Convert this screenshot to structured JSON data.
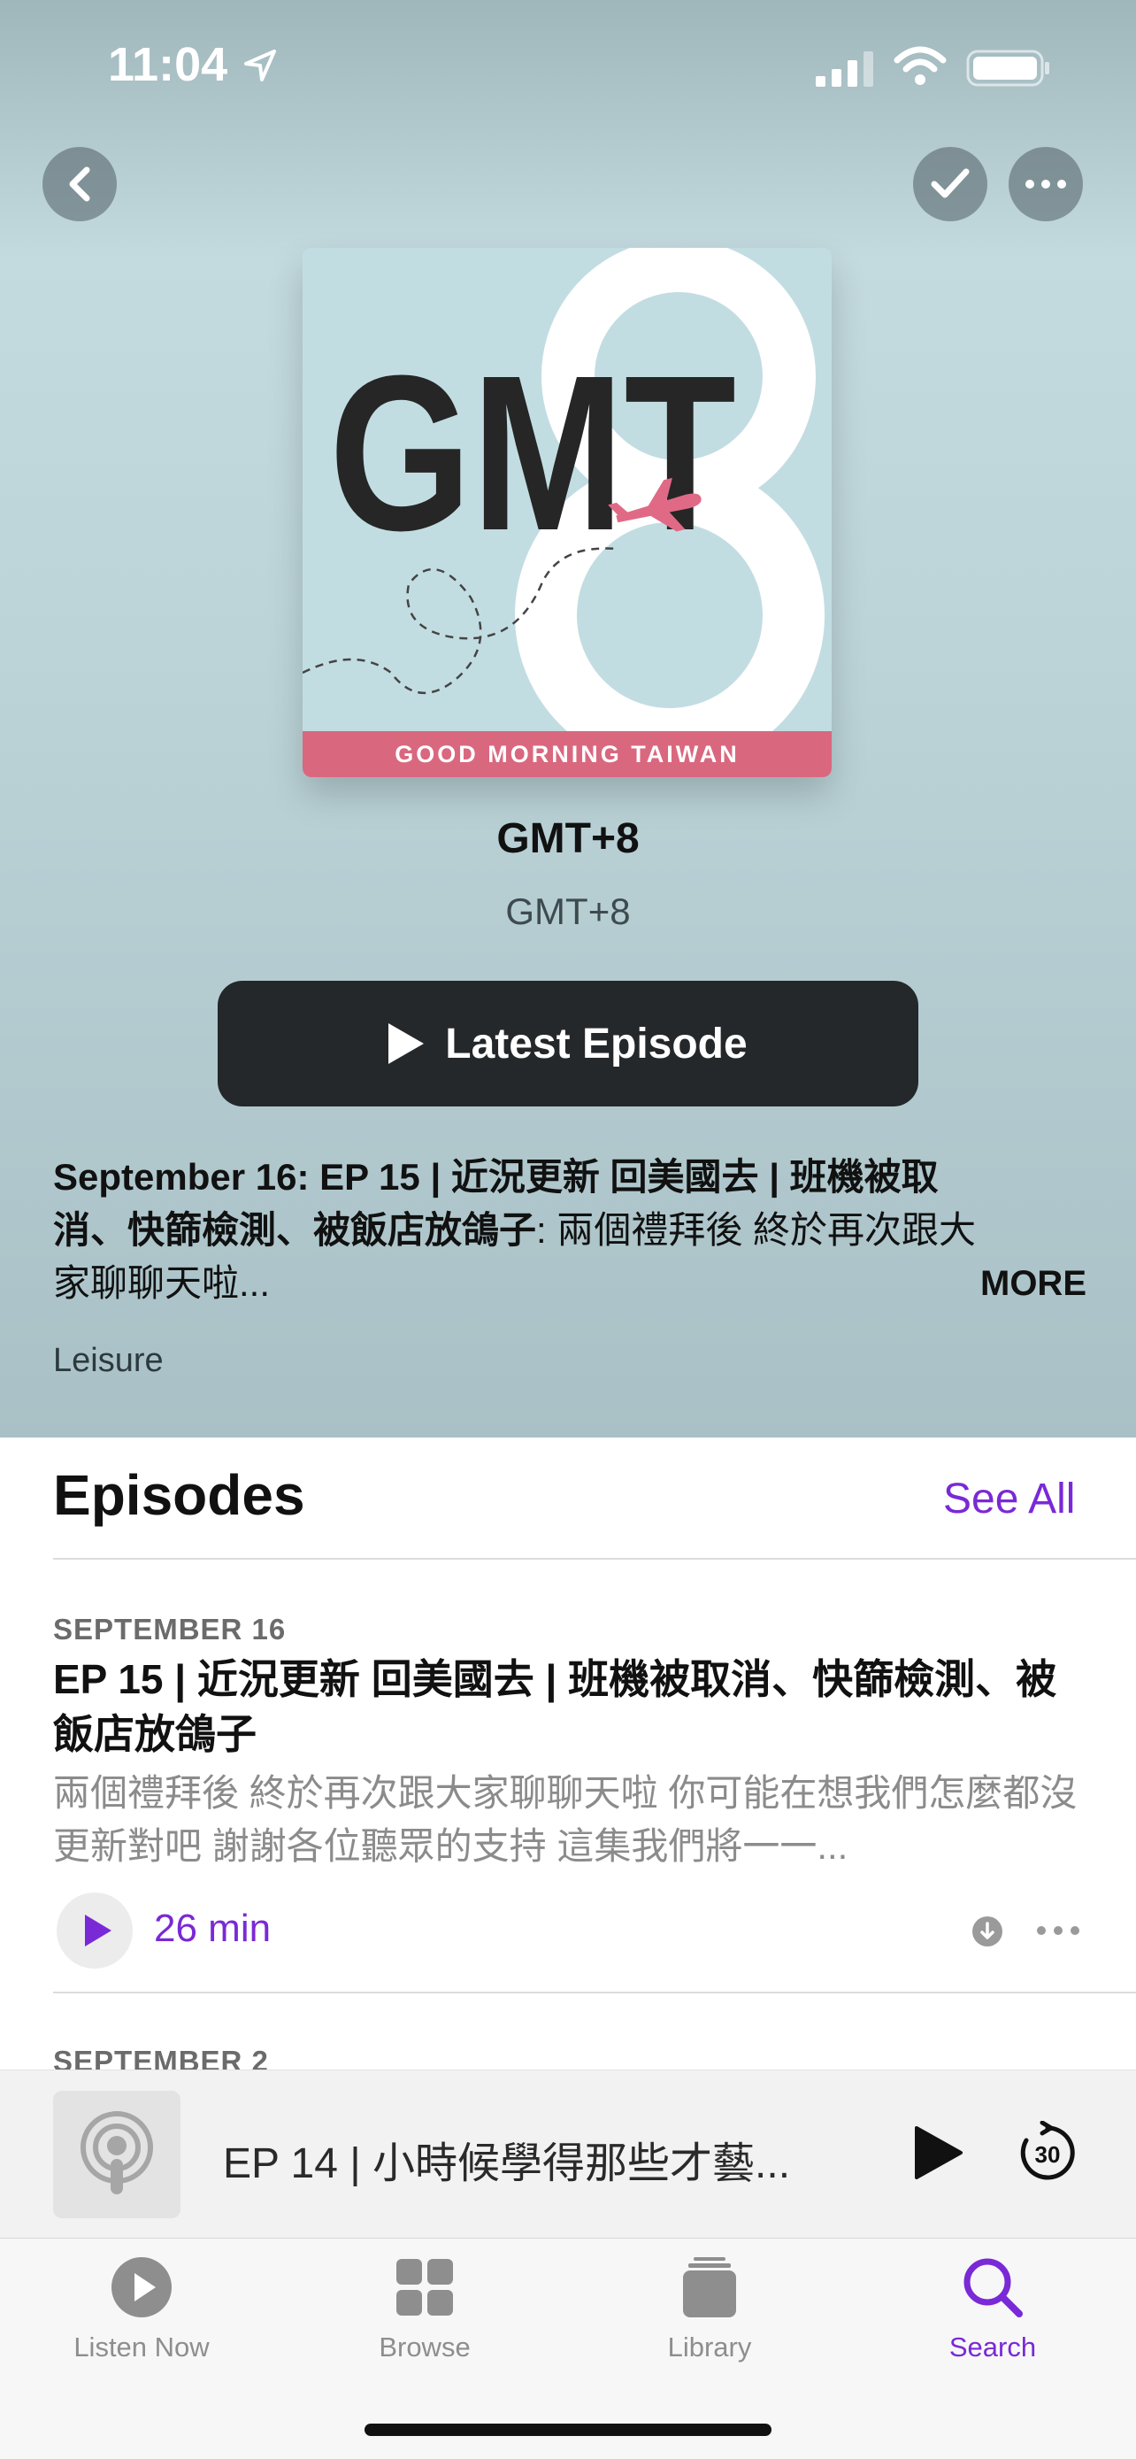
{
  "status_bar": {
    "time": "11:04"
  },
  "show": {
    "title": "GMT+8",
    "author": "GMT+8",
    "artwork": {
      "logo_text": "GMT",
      "logo_numeral": "8",
      "strip_text": "GOOD MORNING TAIWAN"
    },
    "latest_button_label": "Latest Episode",
    "description_bold": "September 16: EP 15 | 近況更新 回美國去 | 班機被取消、快篩檢測、被飯店放鴿子",
    "description_rest": ": 兩個禮拜後 終於再次跟大家聊聊天啦...",
    "more_label": "MORE",
    "category": "Leisure"
  },
  "episodes": {
    "header": "Episodes",
    "see_all_label": "See All",
    "items": [
      {
        "date": "SEPTEMBER 16",
        "title": "EP 15 | 近況更新 回美國去 | 班機被取消、快篩檢測、被飯店放鴿子",
        "summary": "兩個禮拜後 終於再次跟大家聊聊天啦 你可能在想我們怎麼都沒更新對吧 謝謝各位聽眾的支持  這集我們將一一...",
        "duration": "26 min"
      },
      {
        "date": "SEPTEMBER 2"
      }
    ]
  },
  "mini_player": {
    "title": "EP 14 | 小時候學得那些才藝..."
  },
  "tab_bar": {
    "tabs": [
      {
        "label": "Listen Now",
        "icon": "play-circle-icon"
      },
      {
        "label": "Browse",
        "icon": "grid-icon"
      },
      {
        "label": "Library",
        "icon": "stack-icon"
      },
      {
        "label": "Search",
        "icon": "magnifier-icon"
      }
    ],
    "active": "Search"
  },
  "colors": {
    "accent": "#7a29d6",
    "hero_bg": "#bcd4d8",
    "button_dark": "#24282a",
    "strip_pink": "#d9687f",
    "plane_pink": "#e06a86"
  }
}
